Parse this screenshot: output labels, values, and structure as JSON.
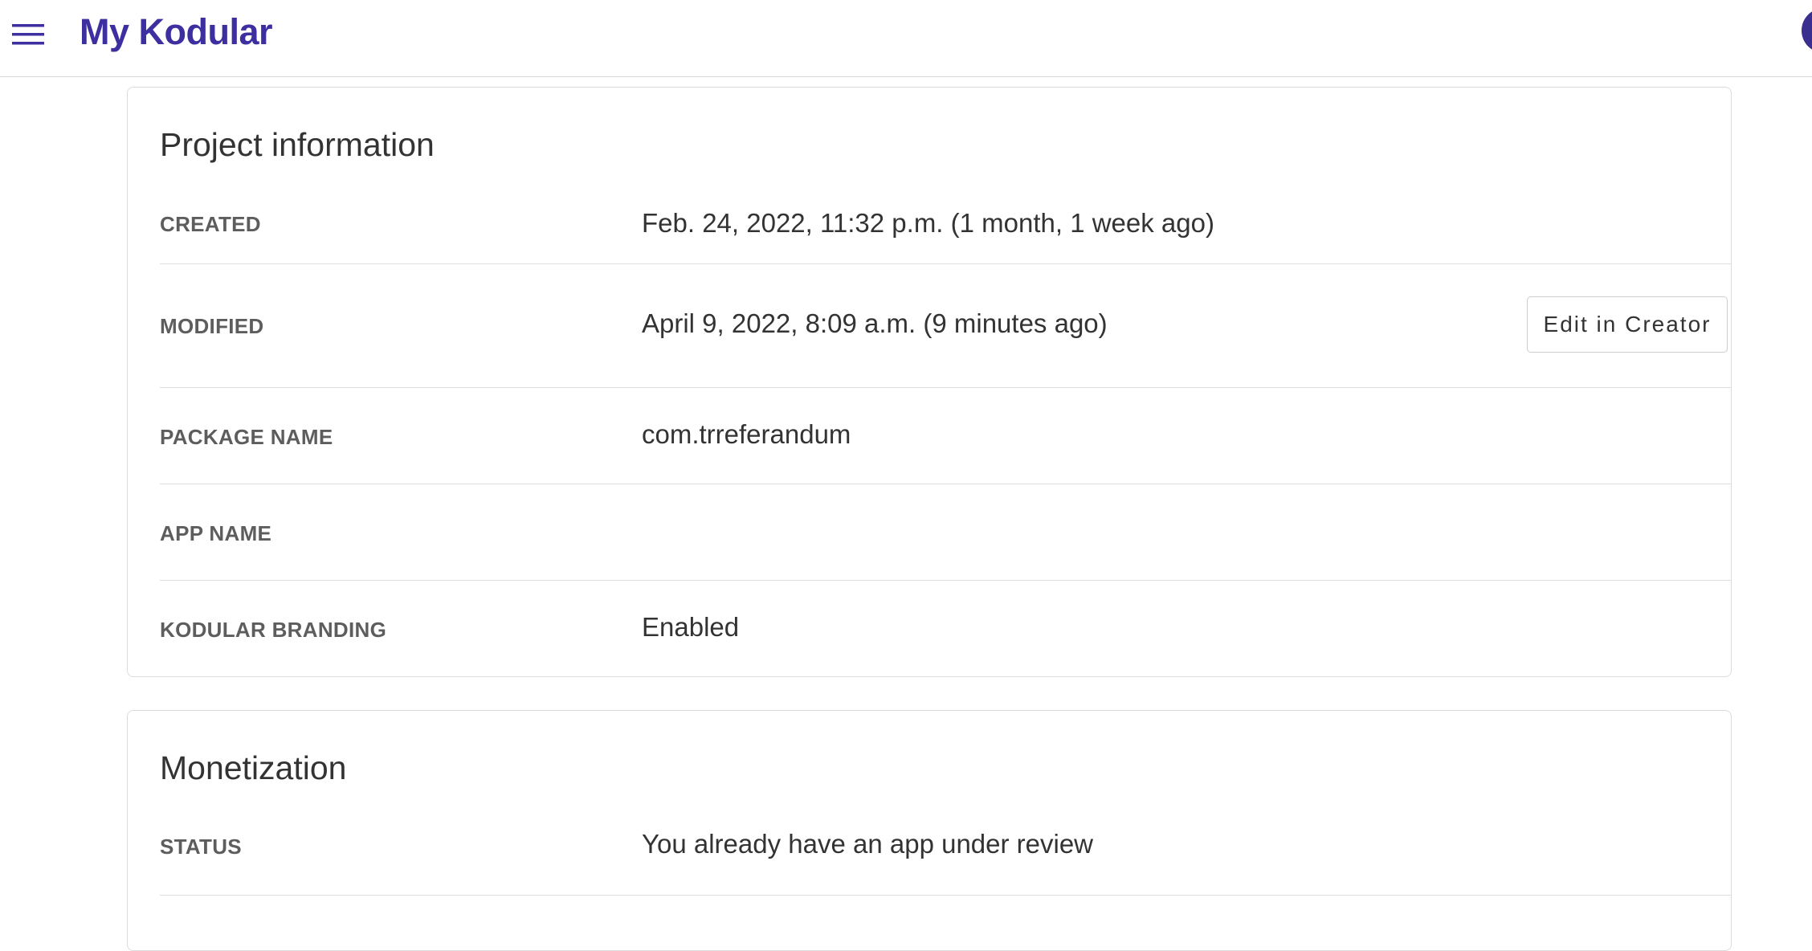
{
  "header": {
    "title": "My Kodular",
    "menu_icon": "menu-icon",
    "accent_color": "#3d2fa0"
  },
  "project_info": {
    "title": "Project information",
    "rows": [
      {
        "label": "CREATED",
        "value": "Feb. 24, 2022, 11:32 p.m. (1 month, 1 week ago)"
      },
      {
        "label": "MODIFIED",
        "value": "April 9, 2022, 8:09 a.m. (9 minutes ago)",
        "action_label": "Edit in Creator"
      },
      {
        "label": "PACKAGE NAME",
        "value": "com.trreferandum"
      },
      {
        "label": "APP NAME",
        "value": ""
      },
      {
        "label": "KODULAR BRANDING",
        "value": "Enabled"
      }
    ]
  },
  "monetization": {
    "title": "Monetization",
    "rows": [
      {
        "label": "STATUS",
        "value": "You already have an app under review"
      }
    ]
  }
}
